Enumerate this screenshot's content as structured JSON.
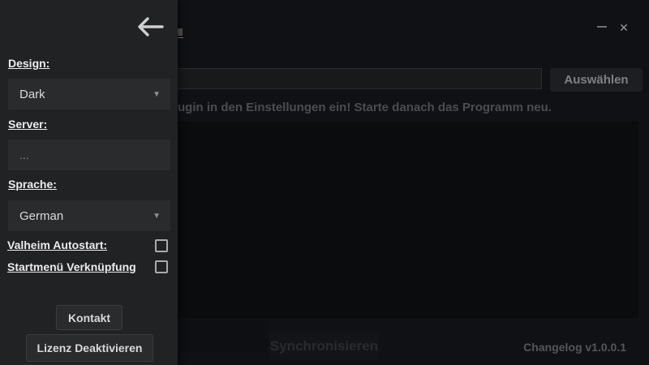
{
  "window": {
    "minimize_icon": "–",
    "close_icon": "✕"
  },
  "sidebar": {
    "back_icon": "arrow-left",
    "design": {
      "label": "Design:",
      "value": "Dark"
    },
    "server": {
      "label": "Server:",
      "value": "..."
    },
    "language": {
      "label": "Sprache:",
      "value": "German"
    },
    "autostart": {
      "label": "Valheim Autostart:",
      "checked": false
    },
    "startmenu": {
      "label": "Startmenü Verknüpfung",
      "checked": false
    },
    "contact_button": "Kontakt",
    "license_button": "Lizenz Deaktivieren"
  },
  "main": {
    "path_input_value": "",
    "choose_button": "Auswählen",
    "notice": "ugin in den Einstellungen ein! Starte danach das Programm neu.",
    "sync_button": "Synchronisieren",
    "changelog_label": "Changelog v1.0.0.1"
  },
  "colors": {
    "sidebar_bg": "#212224",
    "field_bg": "#2a2b2d",
    "window_bg": "#101114",
    "panel_bg": "#0b0c0e",
    "label_text": "#ececec",
    "disabled_text": "#282b30"
  }
}
